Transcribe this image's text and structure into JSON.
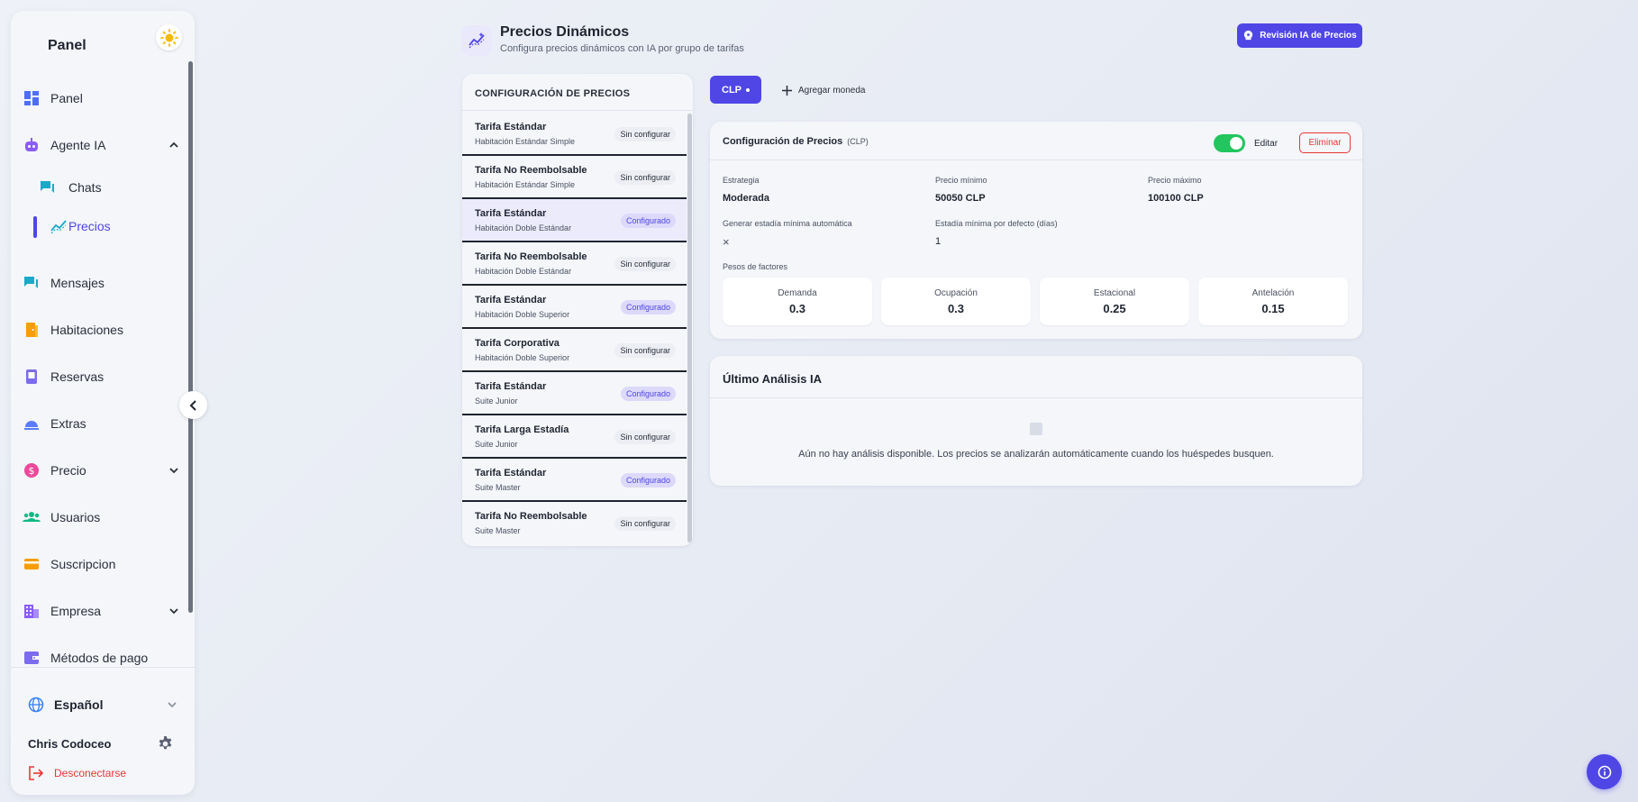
{
  "sidebar": {
    "title": "Panel",
    "items": [
      {
        "label": "Panel"
      },
      {
        "label": "Agente IA"
      },
      {
        "label": "Chats"
      },
      {
        "label": "Precios"
      },
      {
        "label": "Mensajes"
      },
      {
        "label": "Habitaciones"
      },
      {
        "label": "Reservas"
      },
      {
        "label": "Extras"
      },
      {
        "label": "Precio"
      },
      {
        "label": "Usuarios"
      },
      {
        "label": "Suscripcion"
      },
      {
        "label": "Empresa"
      },
      {
        "label": "Métodos de pago"
      }
    ],
    "language": "Español",
    "user_name": "Chris Codoceo",
    "logout_label": "Desconectarse"
  },
  "header": {
    "title": "Precios Dinámicos",
    "subtitle": "Configura precios dinámicos con IA por grupo de tarifas",
    "review_button": "Revisión IA de Precios"
  },
  "rates": {
    "heading": "CONFIGURACIÓN DE PRECIOS",
    "items": [
      {
        "name": "Tarifa Estándar",
        "room": "Habitación Estándar Simple",
        "status": "Sin configurar"
      },
      {
        "name": "Tarifa No Reembolsable",
        "room": "Habitación Estándar Simple",
        "status": "Sin configurar"
      },
      {
        "name": "Tarifa Estándar",
        "room": "Habitación Doble Estándar",
        "status": "Configurado"
      },
      {
        "name": "Tarifa No Reembolsable",
        "room": "Habitación Doble Estándar",
        "status": "Sin configurar"
      },
      {
        "name": "Tarifa Estándar",
        "room": "Habitación Doble Superior",
        "status": "Configurado"
      },
      {
        "name": "Tarifa Corporativa",
        "room": "Habitación Doble Superior",
        "status": "Sin configurar"
      },
      {
        "name": "Tarifa Estándar",
        "room": "Suite Junior",
        "status": "Configurado"
      },
      {
        "name": "Tarifa Larga Estadía",
        "room": "Suite Junior",
        "status": "Sin configurar"
      },
      {
        "name": "Tarifa Estándar",
        "room": "Suite Master",
        "status": "Configurado"
      },
      {
        "name": "Tarifa No Reembolsable",
        "room": "Suite Master",
        "status": "Sin configurar"
      }
    ]
  },
  "currency": {
    "active": "CLP",
    "add_label": "Agregar moneda"
  },
  "config": {
    "title": "Configuración de Precios",
    "currency_tag": "(CLP)",
    "enabled": true,
    "edit_label": "Editar",
    "delete_label": "Eliminar",
    "strategy_label": "Estrategia",
    "strategy_value": "Moderada",
    "min_price_label": "Precio mínimo",
    "min_price_value": "50050 CLP",
    "max_price_label": "Precio máximo",
    "max_price_value": "100100 CLP",
    "auto_min_stay_label": "Generar estadía mínima automática",
    "auto_min_stay_value": "×",
    "default_min_stay_label": "Estadía mínima por defecto (días)",
    "default_min_stay_value": "1",
    "weights_label": "Pesos de factores",
    "weights": [
      {
        "label": "Demanda",
        "value": "0.3"
      },
      {
        "label": "Ocupación",
        "value": "0.3"
      },
      {
        "label": "Estacional",
        "value": "0.25"
      },
      {
        "label": "Antelación",
        "value": "0.15"
      }
    ]
  },
  "analysis": {
    "title": "Último Análisis IA",
    "empty_message": "Aún no hay análisis disponible. Los precios se analizarán automáticamente cuando los huéspedes busquen."
  },
  "colors": {
    "accent": "#4f46e5",
    "success": "#22c55e",
    "danger": "#e53935"
  }
}
